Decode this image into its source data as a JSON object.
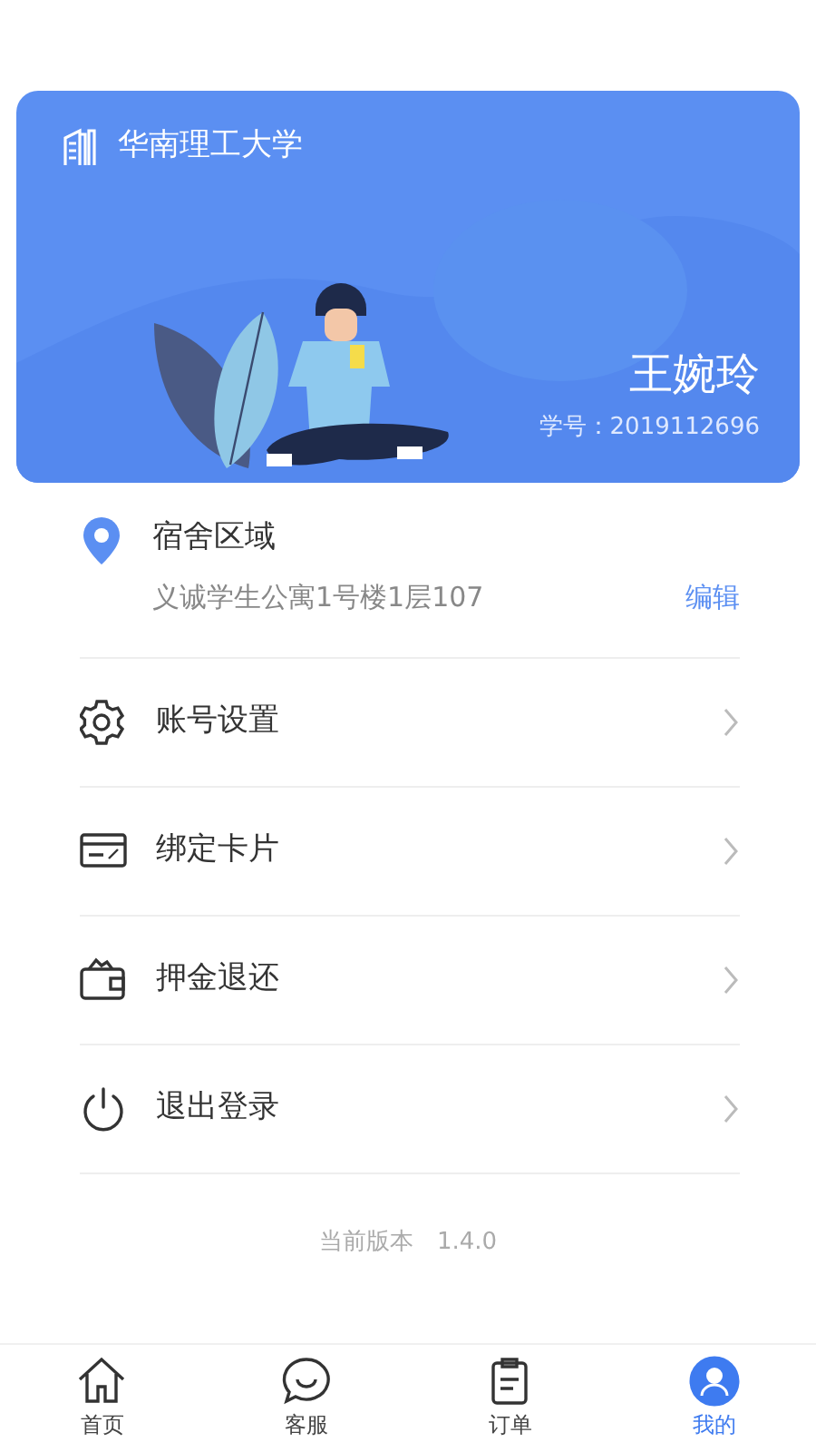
{
  "header": {
    "school": "华南理工大学",
    "name": "王婉玲",
    "student_id": "学号：2019112696"
  },
  "dorm": {
    "title": "宿舍区域",
    "address": "义诚学生公寓1号楼1层107",
    "action": "编辑"
  },
  "menu": [
    {
      "kind": "settings",
      "label": "账号设置"
    },
    {
      "kind": "card",
      "label": "绑定卡片"
    },
    {
      "kind": "wallet",
      "label": "押金退还"
    },
    {
      "kind": "power",
      "label": "退出登录"
    }
  ],
  "version": {
    "label": "当前版本",
    "value": "1.4.0"
  },
  "tabs": [
    {
      "kind": "home",
      "label": "首页",
      "selected": false
    },
    {
      "kind": "chat",
      "label": "客服",
      "selected": false
    },
    {
      "kind": "orders",
      "label": "订单",
      "selected": false
    },
    {
      "kind": "me",
      "label": "我的",
      "selected": true
    }
  ]
}
